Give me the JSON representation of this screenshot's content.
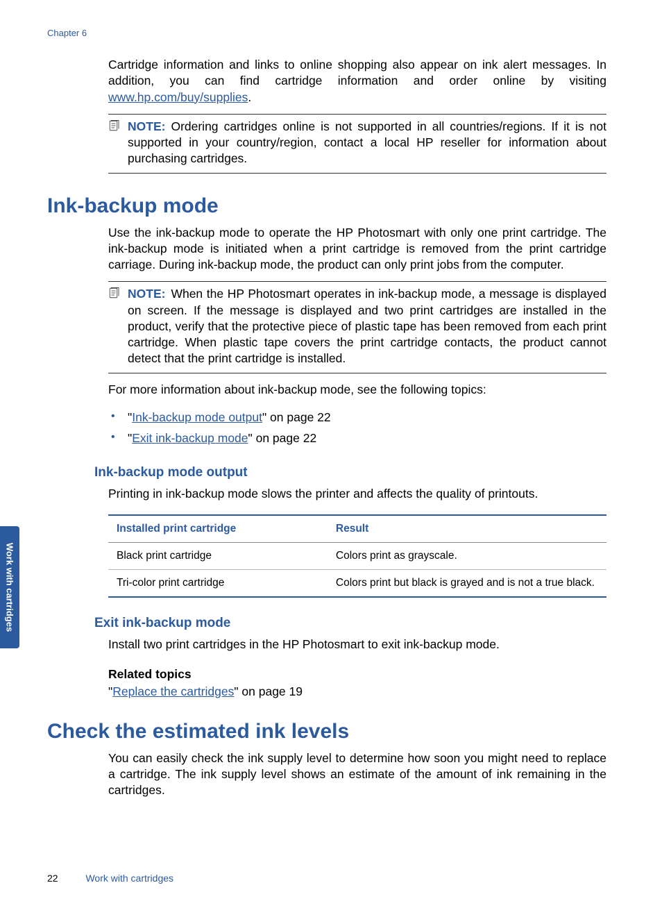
{
  "chapter": "Chapter 6",
  "sideTab": "Work with cartridges",
  "footer": {
    "page": "22",
    "title": "Work with cartridges"
  },
  "intro": {
    "para1a": "Cartridge information and links to online shopping also appear on ink alert messages. In addition, you can find cartridge information and order online by visiting ",
    "link1": "www.hp.com/buy/supplies",
    "para1b": "."
  },
  "note1": {
    "label": "NOTE:",
    "text": "Ordering cartridges online is not supported in all countries/regions. If it is not supported in your country/region, contact a local HP reseller for information about purchasing cartridges."
  },
  "section1": {
    "heading": "Ink-backup mode",
    "para": "Use the ink-backup mode to operate the HP Photosmart with only one print cartridge. The ink-backup mode is initiated when a print cartridge is removed from the print cartridge carriage. During ink-backup mode, the product can only print jobs from the computer.",
    "note": {
      "label": "NOTE:",
      "text": "When the HP Photosmart operates in ink-backup mode, a message is displayed on screen. If the message is displayed and two print cartridges are installed in the product, verify that the protective piece of plastic tape has been removed from each print cartridge. When plastic tape covers the print cartridge contacts, the product cannot detect that the print cartridge is installed."
    },
    "moreInfo": "For more information about ink-backup mode, see the following topics:",
    "links": [
      {
        "pre": "\"",
        "text": "Ink-backup mode output",
        "post": "\" on page 22"
      },
      {
        "pre": "\"",
        "text": "Exit ink-backup mode",
        "post": "\" on page 22"
      }
    ]
  },
  "section2": {
    "heading": "Ink-backup mode output",
    "para": "Printing in ink-backup mode slows the printer and affects the quality of printouts.",
    "table": {
      "colA": "Installed print cartridge",
      "colB": "Result",
      "rows": [
        {
          "a": "Black print cartridge",
          "b": "Colors print as grayscale."
        },
        {
          "a": "Tri-color print cartridge",
          "b": "Colors print but black is grayed and is not a true black."
        }
      ]
    }
  },
  "section3": {
    "heading": "Exit ink-backup mode",
    "para": "Install two print cartridges in the HP Photosmart to exit ink-backup mode.",
    "relatedLabel": "Related topics",
    "link": {
      "pre": "\"",
      "text": "Replace the cartridges",
      "post": "\" on page 19"
    }
  },
  "section4": {
    "heading": "Check the estimated ink levels",
    "para": "You can easily check the ink supply level to determine how soon you might need to replace a cartridge. The ink supply level shows an estimate of the amount of ink remaining in the cartridges."
  }
}
